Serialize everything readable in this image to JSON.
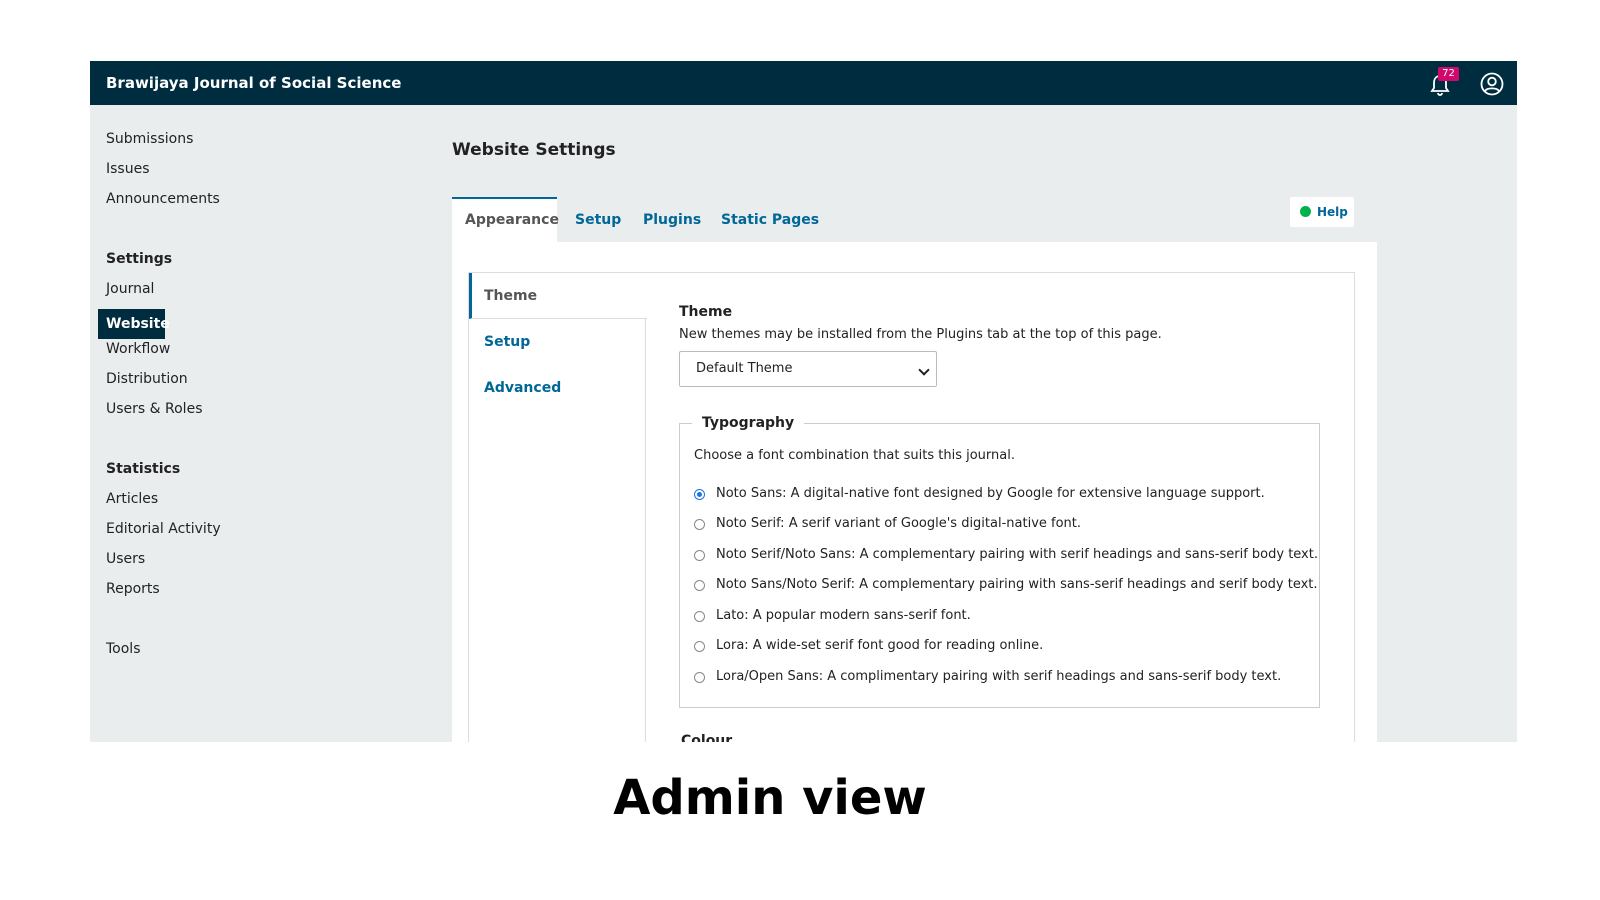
{
  "header": {
    "journal_title": "Brawijaya Journal of Social Science",
    "notification_count": "72"
  },
  "sidebar": {
    "items": [
      "Submissions",
      "Issues",
      "Announcements"
    ],
    "settings_heading": "Settings",
    "settings_items": [
      "Journal",
      "Website",
      "Workflow",
      "Distribution",
      "Users & Roles"
    ],
    "active_item": "Website",
    "statistics_heading": "Statistics",
    "statistics_items": [
      "Articles",
      "Editorial Activity",
      "Users",
      "Reports"
    ],
    "tools": "Tools"
  },
  "main": {
    "page_title": "Website Settings",
    "tabs": [
      "Appearance",
      "Setup",
      "Plugins",
      "Static Pages"
    ],
    "active_tab": "Appearance",
    "help_label": "Help",
    "subtabs": [
      "Theme",
      "Setup",
      "Advanced"
    ],
    "active_subtab": "Theme",
    "theme": {
      "label": "Theme",
      "description": "New themes may be installed from the Plugins tab at the top of this page.",
      "selected": "Default Theme"
    },
    "typography": {
      "legend": "Typography",
      "description": "Choose a font combination that suits this journal.",
      "options": [
        "Noto Sans: A digital-native font designed by Google for extensive language support.",
        "Noto Serif: A serif variant of Google's digital-native font.",
        "Noto Serif/Noto Sans: A complementary pairing with serif headings and sans-serif body text.",
        "Noto Sans/Noto Serif: A complementary pairing with sans-serif headings and serif body text.",
        "Lato: A popular modern sans-serif font.",
        "Lora: A wide-set serif font good for reading online.",
        "Lora/Open Sans: A complimentary pairing with serif headings and sans-serif body text."
      ],
      "selected_index": 0
    },
    "colour_label": "Colour"
  },
  "caption": "Admin view",
  "colors": {
    "header_bg": "#002c40",
    "link": "#006798",
    "badge": "#d00a6c"
  }
}
